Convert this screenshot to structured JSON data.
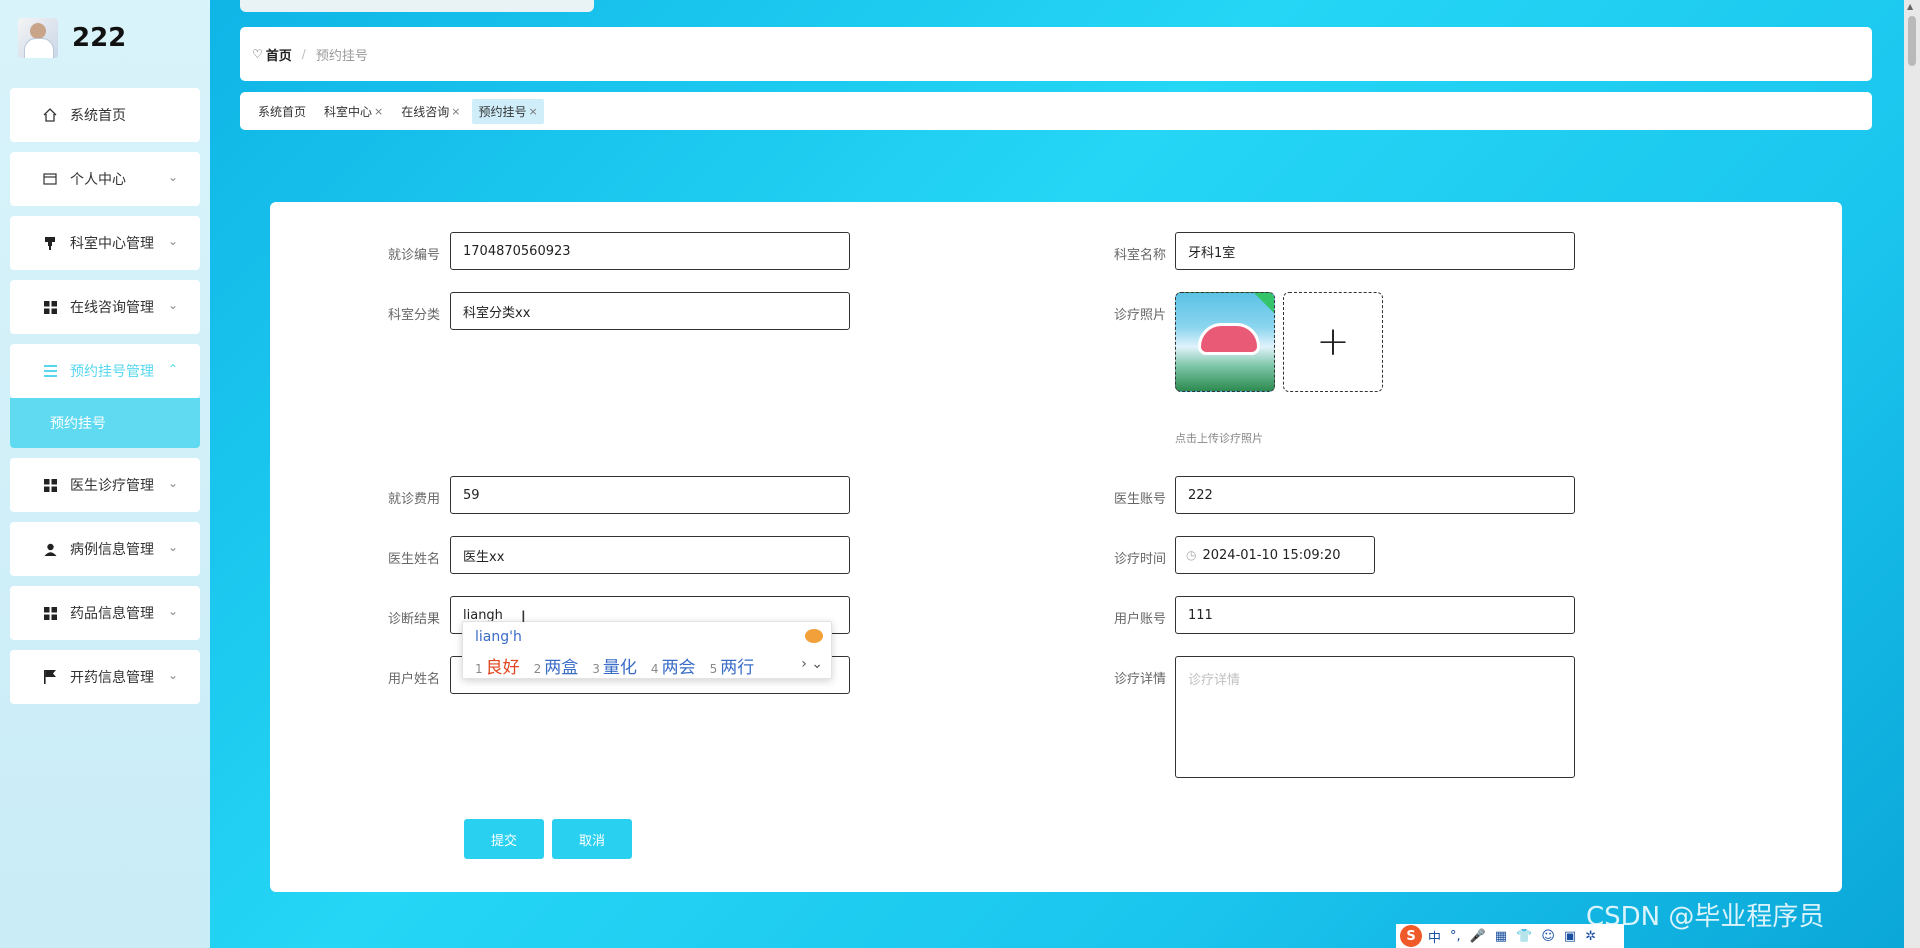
{
  "brand": {
    "name": "222"
  },
  "sidebar": {
    "items": [
      {
        "label": "系统首页",
        "icon": "home-icon",
        "has_chevron": false
      },
      {
        "label": "个人中心",
        "icon": "card-icon",
        "has_chevron": true
      },
      {
        "label": "科室中心管理",
        "icon": "pin-icon",
        "has_chevron": true
      },
      {
        "label": "在线咨询管理",
        "icon": "grid-icon",
        "has_chevron": true
      },
      {
        "label": "预约挂号管理",
        "icon": "list-icon",
        "has_chevron": true,
        "expanded": true
      },
      {
        "label": "医生诊疗管理",
        "icon": "grid-icon",
        "has_chevron": true
      },
      {
        "label": "病例信息管理",
        "icon": "user-icon",
        "has_chevron": true
      },
      {
        "label": "药品信息管理",
        "icon": "grid-icon",
        "has_chevron": true
      },
      {
        "label": "开药信息管理",
        "icon": "flag-icon",
        "has_chevron": true
      }
    ],
    "submenu_label": "预约挂号"
  },
  "breadcrumb": {
    "home": "首页",
    "separator": "/",
    "current": "预约挂号"
  },
  "tabs": [
    {
      "label": "系统首页",
      "closable": false
    },
    {
      "label": "科室中心",
      "closable": true
    },
    {
      "label": "在线咨询",
      "closable": true
    },
    {
      "label": "预约挂号",
      "closable": true,
      "active": true
    }
  ],
  "form": {
    "visit_no": {
      "label": "就诊编号",
      "value": "1704870560923"
    },
    "dept_name": {
      "label": "科室名称",
      "value": "牙科1室"
    },
    "dept_category": {
      "label": "科室分类",
      "value": "科室分类xx"
    },
    "photo": {
      "label": "诊疗照片",
      "hint": "点击上传诊疗照片",
      "upload_symbol": "+"
    },
    "fee": {
      "label": "就诊费用",
      "value": "59"
    },
    "doctor_account": {
      "label": "医生账号",
      "value": "222"
    },
    "doctor_name": {
      "label": "医生姓名",
      "value": "医生xx"
    },
    "visit_time": {
      "label": "诊疗时间",
      "value": "2024-01-10 15:09:20"
    },
    "diagnosis": {
      "label": "诊断结果",
      "value": "liangh"
    },
    "user_account": {
      "label": "用户账号",
      "value": "111"
    },
    "user_name": {
      "label": "用户姓名",
      "value": ""
    },
    "details": {
      "label": "诊疗详情",
      "placeholder": "诊疗详情"
    },
    "submit_label": "提交",
    "cancel_label": "取消"
  },
  "ime": {
    "pinyin": "liang'h",
    "candidates": [
      {
        "n": "1",
        "text": "良好"
      },
      {
        "n": "2",
        "text": "两盒"
      },
      {
        "n": "3",
        "text": "量化"
      },
      {
        "n": "4",
        "text": "两会"
      },
      {
        "n": "5",
        "text": "两行"
      }
    ],
    "nav": "› ⌄"
  },
  "ime_bar": {
    "logo": "S",
    "items": [
      "中",
      "°,",
      "🎤",
      "▦",
      "👕",
      "☺",
      "▣",
      "✲"
    ]
  },
  "watermark": "CSDN @毕业程序员",
  "colors": {
    "accent": "#2ad0ef",
    "active_menu": "#5fdaf1"
  }
}
